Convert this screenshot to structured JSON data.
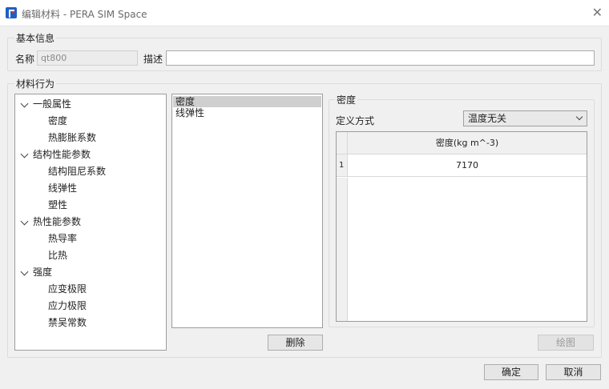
{
  "window": {
    "title": "编辑材料 - PERA SIM Space",
    "close": "✕"
  },
  "basic_info": {
    "group_title": "基本信息",
    "name_label": "名称",
    "name_value": "qt800",
    "desc_label": "描述",
    "desc_value": ""
  },
  "behavior": {
    "group_title": "材料行为",
    "tree": [
      {
        "label": "一般属性",
        "children": [
          "密度",
          "热膨胀系数"
        ]
      },
      {
        "label": "结构性能参数",
        "children": [
          "结构阻尼系数",
          "线弹性",
          "塑性"
        ]
      },
      {
        "label": "热性能参数",
        "children": [
          "热导率",
          "比热"
        ]
      },
      {
        "label": "强度",
        "children": [
          "应变极限",
          "应力极限",
          "禁吴常数"
        ]
      }
    ],
    "selected_list": [
      "密度",
      "线弹性"
    ],
    "delete_label": "删除"
  },
  "density": {
    "group_title": "密度",
    "define_label": "定义方式",
    "define_value": "温度无关",
    "table": {
      "column": "密度(kg m^-3)",
      "rows": [
        {
          "index": "1",
          "value": "7170"
        }
      ]
    },
    "plot_label": "绘图"
  },
  "footer": {
    "ok_label": "确定",
    "cancel_label": "取消"
  },
  "colors": {
    "accent": "#1f5fc4",
    "selection": "#cfcfcf",
    "background": "#f0f0f0"
  }
}
